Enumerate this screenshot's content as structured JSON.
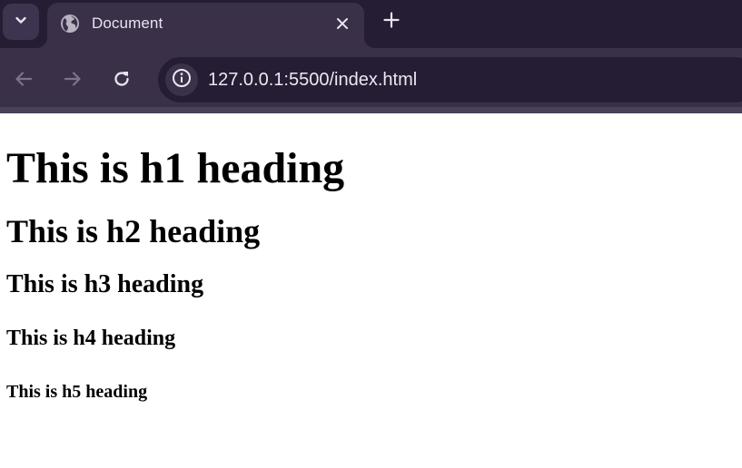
{
  "browser": {
    "tab": {
      "title": "Document",
      "favicon": "globe-icon",
      "close": "close-icon"
    },
    "tab_search": "chevron-down-icon",
    "new_tab": "plus-icon",
    "nav": {
      "back": "arrow-left-icon",
      "forward": "arrow-right-icon",
      "reload": "reload-icon"
    },
    "omnibox": {
      "site_info": "info-icon",
      "url": "127.0.0.1:5500/index.html"
    },
    "colors": {
      "tabstrip_bg": "#241d33",
      "toolbar_bg": "#3a3149",
      "omnibox_bg": "#241d33",
      "page_bg": "#ffffff"
    }
  },
  "page": {
    "h1": "This is h1 heading",
    "h2": "This is h2 heading",
    "h3": "This is h3 heading",
    "h4": "This is h4 heading",
    "h5": "This is h5 heading"
  }
}
